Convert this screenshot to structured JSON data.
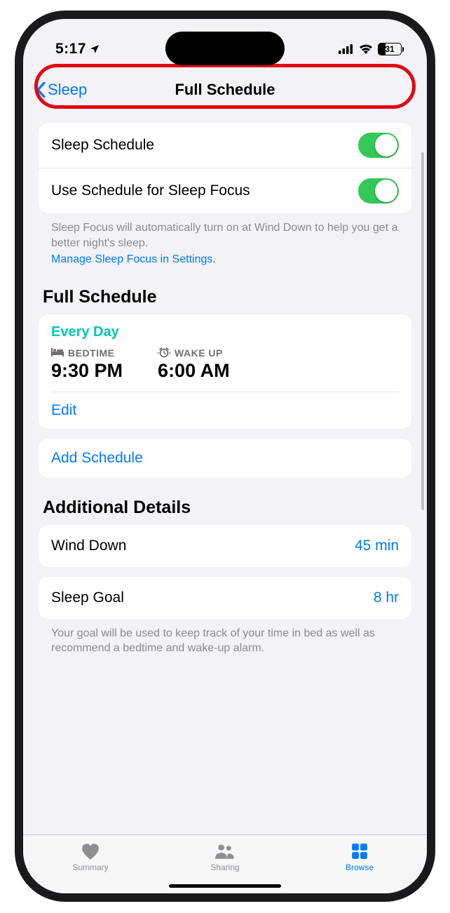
{
  "status": {
    "time": "5:17",
    "battery": "31"
  },
  "nav": {
    "back": "Sleep",
    "title": "Full Schedule"
  },
  "toggles": {
    "sleep_schedule": "Sleep Schedule",
    "sleep_focus": "Use Schedule for Sleep Focus"
  },
  "focus_note": "Sleep Focus will automatically turn on at Wind Down to help you get a better night's sleep.",
  "focus_link": "Manage Sleep Focus in Settings.",
  "sections": {
    "full_schedule": "Full Schedule",
    "additional": "Additional Details"
  },
  "schedule": {
    "frequency": "Every Day",
    "bedtime_label": "BEDTIME",
    "bedtime": "9:30 PM",
    "wake_label": "WAKE UP",
    "wake": "6:00 AM",
    "edit": "Edit",
    "add": "Add Schedule"
  },
  "details": {
    "wind_down_label": "Wind Down",
    "wind_down_value": "45 min",
    "sleep_goal_label": "Sleep Goal",
    "sleep_goal_value": "8 hr",
    "goal_note": "Your goal will be used to keep track of your time in bed as well as recommend a bedtime and wake-up alarm."
  },
  "tabs": {
    "summary": "Summary",
    "sharing": "Sharing",
    "browse": "Browse"
  }
}
